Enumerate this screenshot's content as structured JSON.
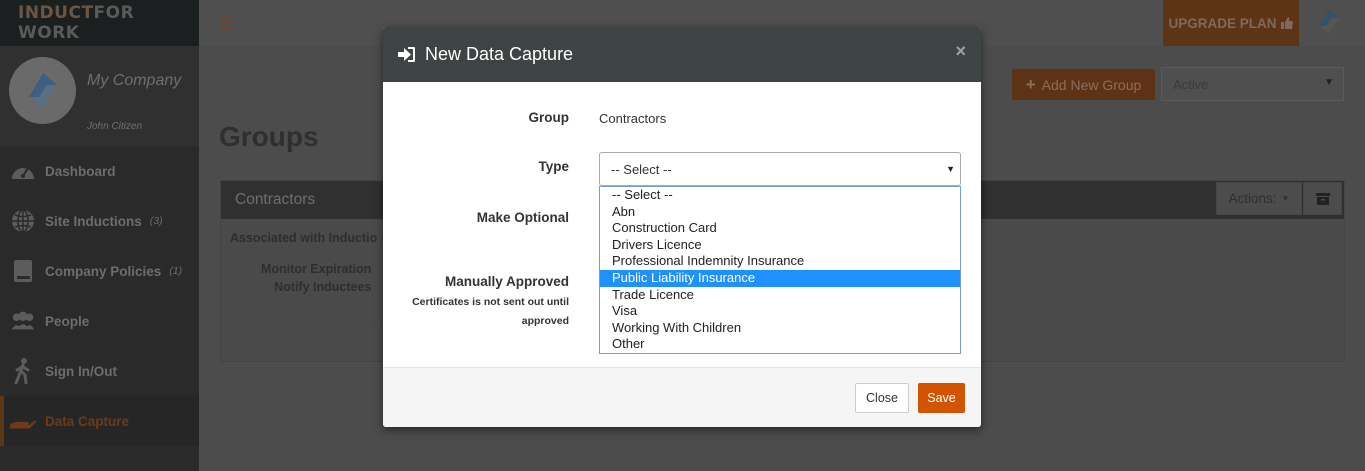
{
  "app": {
    "logo_part1": "INDUCT",
    "logo_part2": "FOR WORK"
  },
  "profile": {
    "company": "My Company",
    "user": "John Citizen"
  },
  "sidebar": {
    "items": [
      {
        "label": "Dashboard",
        "count": "",
        "icon": "dashboard-icon"
      },
      {
        "label": "Site Inductions",
        "count": "(3)",
        "icon": "globe-icon"
      },
      {
        "label": "Company Policies",
        "count": "(1)",
        "icon": "book-icon"
      },
      {
        "label": "People",
        "count": "",
        "icon": "people-icon"
      },
      {
        "label": "Sign In/Out",
        "count": "",
        "icon": "walking-person-icon"
      },
      {
        "label": "Data Capture",
        "count": "",
        "icon": "hand-icon",
        "active": true
      }
    ]
  },
  "topbar": {
    "upgrade_label": "UPGRADE PLAN"
  },
  "main": {
    "title": "Groups",
    "add_group_label": "Add New Group",
    "status_filter": "Active",
    "panel": {
      "title": "Contractors",
      "actions_label": "Actions:",
      "associated_label": "Associated with Inductio",
      "monitor_line1": "Monitor Expiration",
      "monitor_line2": "Notify Inductees"
    }
  },
  "modal": {
    "title": "New Data Capture",
    "close_x": "×",
    "fields": {
      "group_label": "Group",
      "group_value": "Contractors",
      "type_label": "Type",
      "type_value": "-- Select --",
      "optional_label": "Make Optional",
      "manual_label": "Manually Approved",
      "manual_hint": "Certificates is not sent out until approved"
    },
    "type_options": [
      "-- Select --",
      "Abn",
      "Construction Card",
      "Drivers Licence",
      "Professional Indemnity Insurance",
      "Public Liability Insurance",
      "Trade Licence",
      "Visa",
      "Working With Children",
      "Other"
    ],
    "highlighted_option": "Public Liability Insurance",
    "close_label": "Close",
    "save_label": "Save"
  },
  "colors": {
    "accent": "#d35400",
    "highlight": "#1e90ff",
    "modal_header": "#3e4444"
  }
}
